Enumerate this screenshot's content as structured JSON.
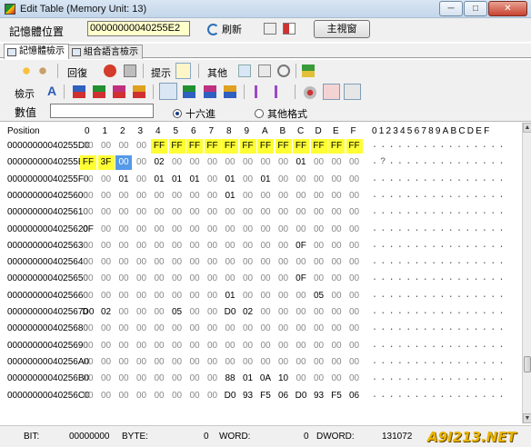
{
  "window": {
    "title": "Edit Table (Memory Unit: 13)",
    "min": "─",
    "max": "□",
    "close": "✕"
  },
  "address_bar": {
    "label": "記憶體位置",
    "value": "00000000040255E2",
    "refresh_label": "刷新",
    "mainview_label": "主視窗"
  },
  "tabs": [
    {
      "label": "記憶體檢示",
      "active": true
    },
    {
      "label": "組合語言檢示",
      "active": false
    }
  ],
  "toolbar1": {
    "restore_label": "回復",
    "display_label": "提示",
    "other_label": "其他"
  },
  "toolbar2": {
    "view_label": "檢示",
    "font_letter": "A"
  },
  "value_row": {
    "label": "數值",
    "input_value": "",
    "radio_hex": "十六進",
    "radio_other": "其他格式",
    "selected": "hex"
  },
  "grid": {
    "position_header": "Position",
    "byte_cols": [
      "0",
      "1",
      "2",
      "3",
      "4",
      "5",
      "6",
      "7",
      "8",
      "9",
      "A",
      "B",
      "C",
      "D",
      "E",
      "F"
    ],
    "ascii_header": "0123456789ABCDEF",
    "rows": [
      {
        "addr": "00000000040255D0",
        "bytes": [
          "00",
          "00",
          "00",
          "00",
          "FF",
          "FF",
          "FF",
          "FF",
          "FF",
          "FF",
          "FF",
          "FF",
          "FF",
          "FF",
          "FF",
          "FF"
        ],
        "hl": [
          4,
          5,
          6,
          7,
          8,
          9,
          10,
          11,
          12,
          13,
          14,
          15
        ],
        "ascii": "................"
      },
      {
        "addr": "00000000040255E0",
        "bytes": [
          "FF",
          "3F",
          "00",
          "00",
          "02",
          "00",
          "00",
          "00",
          "00",
          "00",
          "00",
          "00",
          "01",
          "00",
          "00",
          "00"
        ],
        "hl": [
          0,
          1
        ],
        "sel": [
          2
        ],
        "ascii": ".?.............."
      },
      {
        "addr": "00000000040255F0",
        "bytes": [
          "00",
          "00",
          "01",
          "00",
          "01",
          "01",
          "01",
          "00",
          "01",
          "00",
          "01",
          "00",
          "00",
          "00",
          "00",
          "00"
        ],
        "hl": [],
        "ascii": "................"
      },
      {
        "addr": "0000000004025600",
        "bytes": [
          "00",
          "00",
          "00",
          "00",
          "00",
          "00",
          "00",
          "00",
          "01",
          "00",
          "00",
          "00",
          "00",
          "00",
          "00",
          "00"
        ],
        "hl": [],
        "ascii": "................"
      },
      {
        "addr": "0000000004025610",
        "bytes": [
          "00",
          "00",
          "00",
          "00",
          "00",
          "00",
          "00",
          "00",
          "00",
          "00",
          "00",
          "00",
          "00",
          "00",
          "00",
          "00"
        ],
        "hl": [],
        "ascii": "................"
      },
      {
        "addr": "0000000004025620",
        "bytes": [
          "0F",
          "00",
          "00",
          "00",
          "00",
          "00",
          "00",
          "00",
          "00",
          "00",
          "00",
          "00",
          "00",
          "00",
          "00",
          "00"
        ],
        "hl": [],
        "ascii": "................"
      },
      {
        "addr": "0000000004025630",
        "bytes": [
          "00",
          "00",
          "00",
          "00",
          "00",
          "00",
          "00",
          "00",
          "00",
          "00",
          "00",
          "00",
          "0F",
          "00",
          "00",
          "00"
        ],
        "hl": [],
        "ascii": "................"
      },
      {
        "addr": "0000000004025640",
        "bytes": [
          "00",
          "00",
          "00",
          "00",
          "00",
          "00",
          "00",
          "00",
          "00",
          "00",
          "00",
          "00",
          "00",
          "00",
          "00",
          "00"
        ],
        "hl": [],
        "ascii": "................"
      },
      {
        "addr": "0000000004025650",
        "bytes": [
          "00",
          "00",
          "00",
          "00",
          "00",
          "00",
          "00",
          "00",
          "00",
          "00",
          "00",
          "00",
          "0F",
          "00",
          "00",
          "00"
        ],
        "hl": [],
        "ascii": "................"
      },
      {
        "addr": "0000000004025660",
        "bytes": [
          "00",
          "00",
          "00",
          "00",
          "00",
          "00",
          "00",
          "00",
          "01",
          "00",
          "00",
          "00",
          "00",
          "05",
          "00",
          "00"
        ],
        "hl": [],
        "ascii": "................"
      },
      {
        "addr": "0000000004025670",
        "bytes": [
          "D0",
          "02",
          "00",
          "00",
          "00",
          "05",
          "00",
          "00",
          "D0",
          "02",
          "00",
          "00",
          "00",
          "00",
          "00",
          "00"
        ],
        "hl": [],
        "ascii": "................"
      },
      {
        "addr": "0000000004025680",
        "bytes": [
          "00",
          "00",
          "00",
          "00",
          "00",
          "00",
          "00",
          "00",
          "00",
          "00",
          "00",
          "00",
          "00",
          "00",
          "00",
          "00"
        ],
        "hl": [],
        "ascii": "................"
      },
      {
        "addr": "0000000004025690",
        "bytes": [
          "00",
          "00",
          "00",
          "00",
          "00",
          "00",
          "00",
          "00",
          "00",
          "00",
          "00",
          "00",
          "00",
          "00",
          "00",
          "00"
        ],
        "hl": [],
        "ascii": "................"
      },
      {
        "addr": "00000000040256A0",
        "bytes": [
          "00",
          "00",
          "00",
          "00",
          "00",
          "00",
          "00",
          "00",
          "00",
          "00",
          "00",
          "00",
          "00",
          "00",
          "00",
          "00"
        ],
        "hl": [],
        "ascii": "................"
      },
      {
        "addr": "00000000040256B0",
        "bytes": [
          "00",
          "00",
          "00",
          "00",
          "00",
          "00",
          "00",
          "00",
          "88",
          "01",
          "0A",
          "10",
          "00",
          "00",
          "00",
          "00"
        ],
        "hl": [],
        "ascii": "................"
      },
      {
        "addr": "00000000040256C0",
        "bytes": [
          "00",
          "00",
          "00",
          "00",
          "00",
          "00",
          "00",
          "00",
          "D0",
          "93",
          "F5",
          "06",
          "D0",
          "93",
          "F5",
          "06"
        ],
        "hl": [],
        "ascii": "................"
      }
    ]
  },
  "status_bar": {
    "bit_label": "BIT:",
    "bit_value": "00000000",
    "byte_label": "BYTE:",
    "byte_value": "0",
    "word_label": "WORD:",
    "word_value": "0",
    "dword_label": "DWORD:",
    "dword_value": "131072"
  },
  "watermark": "A9I213.NET",
  "colors": {
    "highlight": "#ffff33",
    "selection": "#5599e8",
    "titlebar": "#c3d6ea"
  }
}
